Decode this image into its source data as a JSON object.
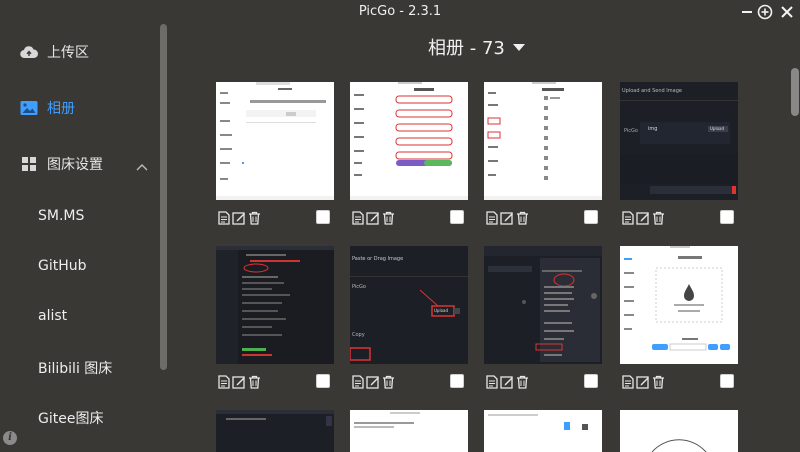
{
  "window": {
    "title": "PicGo - 2.3.1",
    "controls": [
      "minimize-icon",
      "plus-circle-icon",
      "close-icon"
    ]
  },
  "sidebar": {
    "items": [
      {
        "label": "上传区",
        "icon": "cloud-upload-icon",
        "active": false
      },
      {
        "label": "相册",
        "icon": "image-icon",
        "active": true
      },
      {
        "label": "图床设置",
        "icon": "grid-icon",
        "active": false,
        "expanded": true
      }
    ],
    "sub_items": [
      "SM.MS",
      "GitHub",
      "alist",
      "Bilibili 图床",
      "Gitee图床"
    ],
    "info_icon": "info-icon"
  },
  "main": {
    "title": "相册 - 73",
    "thumb_texts": {
      "r1c4": [
        "Upload and Send Image",
        "img",
        "PicGo",
        "Upload"
      ],
      "r2c2": [
        "Paste or Drag Image",
        "PicGo",
        "Upload",
        "Copy"
      ]
    },
    "card_actions": [
      "document-icon",
      "edit-icon",
      "trash-icon",
      "checkbox"
    ]
  },
  "colors": {
    "background": "#3a3835",
    "accent": "#409eff",
    "text": "#e6e6e6"
  }
}
